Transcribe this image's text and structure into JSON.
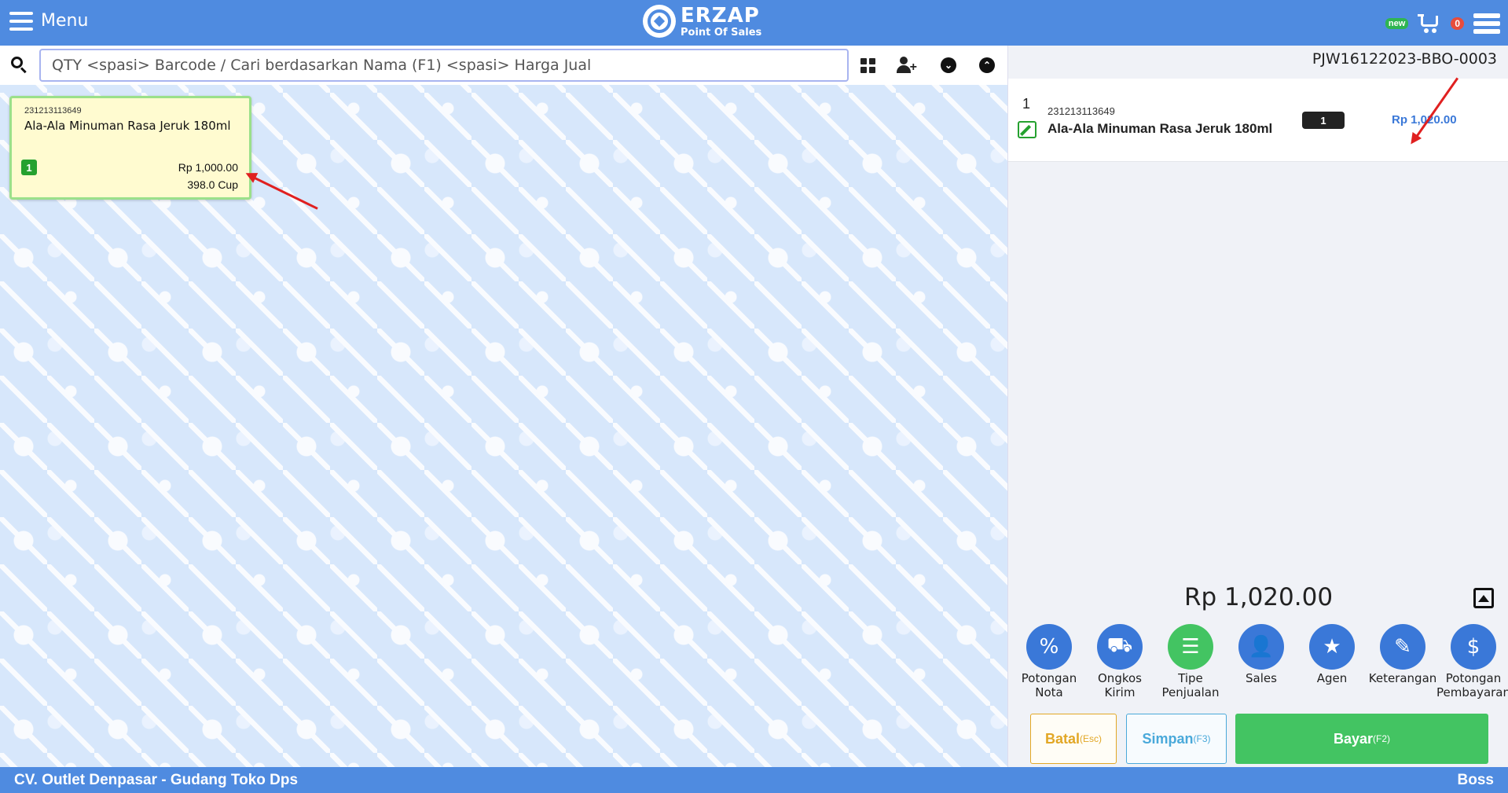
{
  "header": {
    "menu_label": "Menu",
    "brand_name": "ERZAP",
    "brand_sub": "Point Of Sales",
    "new_badge": "new",
    "cart_count": "0"
  },
  "search": {
    "placeholder": "QTY <spasi> Barcode / Cari berdasarkan Nama (F1) <spasi> Harga Jual"
  },
  "toolbar_icons": [
    "grid-icon",
    "user-plus-icon",
    "chevron-down-circle-icon",
    "chevron-up-circle-icon"
  ],
  "product_card": {
    "barcode": "231213113649",
    "name": "Ala-Ala Minuman Rasa Jeruk 180ml",
    "qty": "1",
    "price": "Rp 1,000.00",
    "stock": "398.0 Cup"
  },
  "invoice": {
    "number": "PJW16122023-BBO-0003",
    "items": [
      {
        "index": "1",
        "barcode": "231213113649",
        "name": "Ala-Ala Minuman Rasa Jeruk 180ml",
        "qty": "1",
        "price": "Rp 1,020.00"
      }
    ],
    "total": "Rp 1,020.00"
  },
  "actions": [
    {
      "label_1": "Potongan",
      "label_2": "Nota",
      "icon": "discount-icon"
    },
    {
      "label_1": "Ongkos",
      "label_2": "Kirim",
      "icon": "truck-icon"
    },
    {
      "label_1": "Tipe",
      "label_2": "Penjualan",
      "icon": "list-icon"
    },
    {
      "label_1": "Sales",
      "label_2": "",
      "icon": "user-icon"
    },
    {
      "label_1": "Agen",
      "label_2": "",
      "icon": "agent-icon"
    },
    {
      "label_1": "Keterangan",
      "label_2": "",
      "icon": "edit-icon"
    },
    {
      "label_1": "Potongan",
      "label_2": "Pembayaran",
      "icon": "payment-discount-icon"
    }
  ],
  "buttons": {
    "batal": "Batal",
    "batal_hint": "(Esc)",
    "simpan": "Simpan",
    "simpan_hint": "(F3)",
    "bayar": "Bayar",
    "bayar_hint": "(F2)"
  },
  "footer": {
    "outlet": "CV. Outlet Denpasar - Gudang Toko Dps",
    "user": "Boss"
  },
  "colors": {
    "primary": "#4f8be0",
    "green": "#43c462",
    "price_blue": "#3a78d8",
    "batal": "#e2a726",
    "simpan": "#4aa9da",
    "annotation_red": "#e02020"
  }
}
